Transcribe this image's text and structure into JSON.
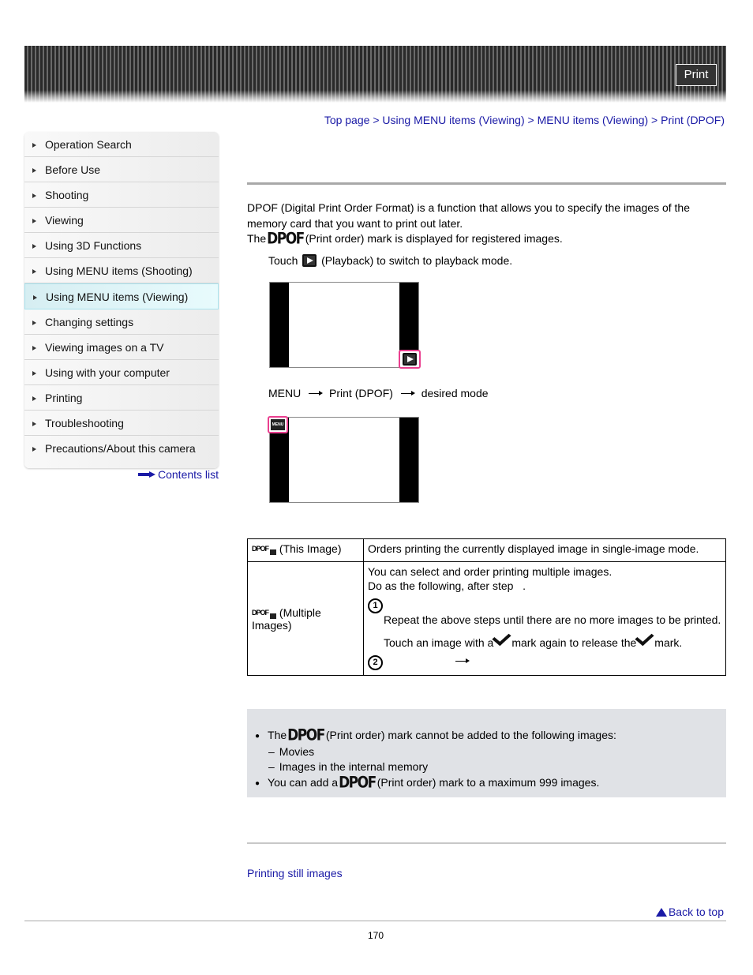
{
  "header": {
    "print_label": "Print"
  },
  "sidebar": {
    "items": [
      {
        "label": "Operation Search",
        "active": false
      },
      {
        "label": "Before Use",
        "active": false
      },
      {
        "label": "Shooting",
        "active": false
      },
      {
        "label": "Viewing",
        "active": false
      },
      {
        "label": "Using 3D Functions",
        "active": false
      },
      {
        "label": "Using MENU items (Shooting)",
        "active": false
      },
      {
        "label": "Using MENU items (Viewing)",
        "active": true
      },
      {
        "label": "Changing settings",
        "active": false
      },
      {
        "label": "Viewing images on a TV",
        "active": false
      },
      {
        "label": "Using with your computer",
        "active": false
      },
      {
        "label": "Printing",
        "active": false
      },
      {
        "label": "Troubleshooting",
        "active": false
      },
      {
        "label": "Precautions/About this camera",
        "active": false
      }
    ],
    "contents_link": "Contents list"
  },
  "breadcrumb": {
    "items": [
      "Top page",
      "Using MENU items (Viewing)",
      "MENU items (Viewing)",
      "Print (DPOF)"
    ],
    "separator": ">"
  },
  "intro": {
    "line1": "DPOF (Digital Print Order Format) is a function that allows you to specify the images of the memory card that you want to print out later.",
    "line2_pre": "The",
    "dpof_mark": "DPOF",
    "line2_post": "(Print order) mark is displayed for registered images."
  },
  "steps": {
    "step1_pre": "Touch",
    "step1_post": "(Playback) to switch to playback mode.",
    "step2_a": "MENU",
    "step2_b": "Print (DPOF)",
    "step2_c": "desired mode",
    "menu_icon_text": "MENU"
  },
  "table": {
    "rows": [
      {
        "mode_icon": "DPOF",
        "mode": "(This Image)",
        "desc": "Orders printing the currently displayed image in single-image mode."
      },
      {
        "mode_icon": "DPOF",
        "mode": "(Multiple Images)",
        "desc_line1": "You can select and order printing multiple images.",
        "desc_line2": "Do as the following, after step   .",
        "sub1_num": "1",
        "sub1_text1": "Repeat the above steps until there are no more images to be printed.",
        "sub1_text2_a": "Touch an image with a",
        "sub1_text2_b": "mark again to release the",
        "sub1_text2_c": "mark.",
        "sub2_num": "2"
      }
    ]
  },
  "notes": {
    "item1_pre": "The",
    "item1_post": "(Print order) mark cannot be added to the following images:",
    "sub1": "Movies",
    "sub2": "Images in the internal memory",
    "item2_pre": "You can add a",
    "item2_post": "(Print order) mark to a maximum 999 images."
  },
  "related": {
    "link": "Printing still images"
  },
  "footer": {
    "back_to_top": "Back to top",
    "page_number": "170"
  },
  "colors": {
    "link": "#1a1aa6",
    "highlight": "#ea3f8f",
    "note_bg": "#e0e2e6",
    "active_nav": "#d6eef2"
  }
}
